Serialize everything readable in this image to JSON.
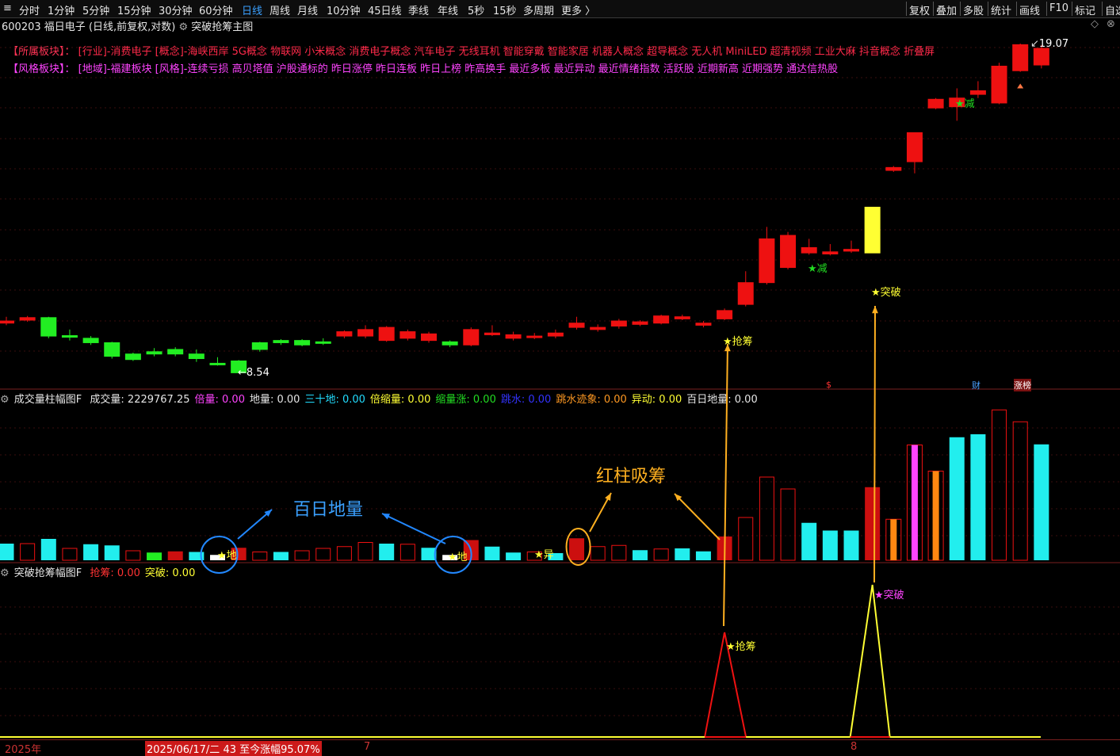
{
  "toolbar": {
    "periods": [
      "分时",
      "1分钟",
      "5分钟",
      "15分钟",
      "30分钟",
      "60分钟",
      "日线",
      "周线",
      "月线",
      "10分钟",
      "45日线",
      "季线",
      "年线",
      "5秒",
      "15秒",
      "多周期",
      "更多 〉"
    ],
    "active": "日线",
    "right_buttons": [
      "复权",
      "叠加",
      "多股",
      "统计",
      "画线",
      "F10",
      "标记",
      "自选"
    ]
  },
  "stock": {
    "code": "600203",
    "name": "福日电子",
    "mode": "(日线,前复权,对数)",
    "indicator": "突破抢筹主图"
  },
  "sectors": {
    "row1_label": "【所属板块】：",
    "row1_text": "[行业]-消费电子 [概念]-海峡西岸 5G概念 物联网 小米概念 消费电子概念 汽车电子 无线耳机 智能穿戴 智能家居 机器人概念 超导概念 无人机 MiniLED 超清视频 工业大麻 抖音概念 折叠屏",
    "row2_label": "【风格板块】：",
    "row2_text": "[地域]-福建板块 [风格]-连续亏损 高贝塔值 沪股通标的 昨日涨停 昨日连板 昨日上榜 昨高换手 最近多板 最近异动 最近情绪指数 活跃股 近期新高 近期强势 通达信热股"
  },
  "main_chart": {
    "high_label": "19.07",
    "low_label": "8.54",
    "low_arrow": "←",
    "signals": {
      "qiangchou": "★抢筹",
      "tupo": "★突破",
      "jian": "★减"
    },
    "markers": {
      "dollar": "$",
      "cai": "财",
      "zhangbang": "涨榜"
    }
  },
  "volume_panel": {
    "title": "成交量柱幅图F",
    "fields": [
      {
        "k": "成交量:",
        "v": "2229767.25",
        "color": "#e6e6e6"
      },
      {
        "k": "倍量:",
        "v": "0.00",
        "color": "#ff44ff"
      },
      {
        "k": "地量:",
        "v": "0.00",
        "color": "#e6e6e6"
      },
      {
        "k": "三十地:",
        "v": "0.00",
        "color": "#22ddff"
      },
      {
        "k": "倍缩量:",
        "v": "0.00",
        "color": "#ffff33"
      },
      {
        "k": "缩量涨:",
        "v": "0.00",
        "color": "#22dd22"
      },
      {
        "k": "跳水:",
        "v": "0.00",
        "color": "#3333ff"
      },
      {
        "k": "跳水迹象:",
        "v": "0.00",
        "color": "#ff9922"
      },
      {
        "k": "异动:",
        "v": "0.00",
        "color": "#ffff33"
      },
      {
        "k": "百日地量:",
        "v": "0.00",
        "color": "#e6e6e6"
      }
    ],
    "tags": {
      "di": "★地",
      "yi": "★异"
    },
    "annotations": {
      "bairi": "百日地量",
      "hongzhu": "红柱吸筹"
    }
  },
  "breakout_panel": {
    "title": "突破抢筹幅图F",
    "fields": [
      {
        "k": "抢筹:",
        "v": "0.00",
        "color": "#ff3333"
      },
      {
        "k": "突破:",
        "v": "0.00",
        "color": "#ffff33"
      }
    ],
    "peak_labels": {
      "qiangchou": "★抢筹",
      "tupo": "★突破"
    }
  },
  "status_bar": {
    "year": "2025年",
    "info": "2025/06/17/二 43 至今涨幅95.07%",
    "mark7": "7",
    "mark8": "8"
  },
  "candles": [
    {
      "t": "u",
      "o": 9.65,
      "c": 9.7,
      "h": 9.8,
      "l": 9.6
    },
    {
      "t": "u",
      "o": 9.72,
      "c": 9.78,
      "h": 9.82,
      "l": 9.68
    },
    {
      "t": "d",
      "o": 9.78,
      "c": 9.35,
      "h": 9.8,
      "l": 9.3
    },
    {
      "t": "d",
      "o": 9.36,
      "c": 9.33,
      "h": 9.5,
      "l": 9.25
    },
    {
      "t": "d",
      "o": 9.3,
      "c": 9.2,
      "h": 9.35,
      "l": 9.15
    },
    {
      "t": "d",
      "o": 9.2,
      "c": 8.9,
      "h": 9.22,
      "l": 8.85
    },
    {
      "t": "d",
      "o": 8.95,
      "c": 8.83,
      "h": 8.98,
      "l": 8.8
    },
    {
      "t": "d",
      "o": 9.0,
      "c": 8.95,
      "h": 9.08,
      "l": 8.9
    },
    {
      "t": "d",
      "o": 9.05,
      "c": 8.95,
      "h": 9.1,
      "l": 8.9
    },
    {
      "t": "d",
      "o": 8.95,
      "c": 8.85,
      "h": 9.05,
      "l": 8.78
    },
    {
      "t": "d",
      "o": 8.75,
      "c": 8.73,
      "h": 8.88,
      "l": 8.7
    },
    {
      "t": "d",
      "o": 8.8,
      "c": 8.55,
      "h": 8.82,
      "l": 8.54
    },
    {
      "t": "d",
      "o": 9.2,
      "c": 9.05,
      "h": 9.22,
      "l": 9.0
    },
    {
      "t": "d",
      "o": 9.25,
      "c": 9.2,
      "h": 9.28,
      "l": 9.15
    },
    {
      "t": "d",
      "o": 9.25,
      "c": 9.15,
      "h": 9.28,
      "l": 9.12
    },
    {
      "t": "d",
      "o": 9.22,
      "c": 9.2,
      "h": 9.3,
      "l": 9.15
    },
    {
      "t": "u",
      "o": 9.35,
      "c": 9.45,
      "h": 9.48,
      "l": 9.3
    },
    {
      "t": "u",
      "o": 9.35,
      "c": 9.5,
      "h": 9.6,
      "l": 9.3
    },
    {
      "t": "u",
      "o": 9.25,
      "c": 9.55,
      "h": 9.58,
      "l": 9.22
    },
    {
      "t": "u",
      "o": 9.3,
      "c": 9.45,
      "h": 9.5,
      "l": 9.25
    },
    {
      "t": "u",
      "o": 9.25,
      "c": 9.4,
      "h": 9.45,
      "l": 9.2
    },
    {
      "t": "d",
      "o": 9.22,
      "c": 9.15,
      "h": 9.25,
      "l": 9.1
    },
    {
      "t": "u",
      "o": 9.15,
      "c": 9.5,
      "h": 9.55,
      "l": 9.12
    },
    {
      "t": "u",
      "o": 9.38,
      "c": 9.42,
      "h": 9.6,
      "l": 9.35
    },
    {
      "t": "u",
      "o": 9.3,
      "c": 9.38,
      "h": 9.45,
      "l": 9.25
    },
    {
      "t": "u",
      "o": 9.32,
      "c": 9.35,
      "h": 9.42,
      "l": 9.28
    },
    {
      "t": "u",
      "o": 9.35,
      "c": 9.42,
      "h": 9.5,
      "l": 9.3
    },
    {
      "t": "u",
      "o": 9.55,
      "c": 9.65,
      "h": 9.8,
      "l": 9.5
    },
    {
      "t": "u",
      "o": 9.5,
      "c": 9.55,
      "h": 9.62,
      "l": 9.45
    },
    {
      "t": "u",
      "o": 9.58,
      "c": 9.7,
      "h": 9.75,
      "l": 9.52
    },
    {
      "t": "u",
      "o": 9.62,
      "c": 9.68,
      "h": 9.72,
      "l": 9.58
    },
    {
      "t": "u",
      "o": 9.65,
      "c": 9.82,
      "h": 9.85,
      "l": 9.62
    },
    {
      "t": "u",
      "o": 9.75,
      "c": 9.8,
      "h": 9.85,
      "l": 9.72
    },
    {
      "t": "u",
      "o": 9.6,
      "c": 9.65,
      "h": 9.7,
      "l": 9.55
    },
    {
      "t": "u",
      "o": 9.75,
      "c": 9.95,
      "h": 10.0,
      "l": 9.72
    },
    {
      "t": "u",
      "o": 10.1,
      "c": 10.65,
      "h": 10.95,
      "l": 10.05
    },
    {
      "t": "u",
      "o": 10.65,
      "c": 11.85,
      "h": 12.2,
      "l": 10.6
    },
    {
      "t": "u",
      "o": 11.05,
      "c": 11.95,
      "h": 12.05,
      "l": 11.0
    },
    {
      "t": "u",
      "o": 11.45,
      "c": 11.6,
      "h": 11.85,
      "l": 11.4
    },
    {
      "t": "u",
      "o": 11.42,
      "c": 11.48,
      "h": 11.7,
      "l": 11.38
    },
    {
      "t": "u",
      "o": 11.5,
      "c": 11.55,
      "h": 11.8,
      "l": 11.45
    },
    {
      "t": "y",
      "o": 11.45,
      "c": 12.8,
      "h": 12.8,
      "l": 11.45
    },
    {
      "t": "u",
      "o": 14.0,
      "c": 14.1,
      "h": 14.15,
      "l": 13.95
    },
    {
      "t": "u",
      "o": 14.3,
      "c": 15.35,
      "h": 15.35,
      "l": 13.9
    },
    {
      "t": "u",
      "o": 16.3,
      "c": 16.65,
      "h": 16.7,
      "l": 16.25
    },
    {
      "t": "u",
      "o": 16.35,
      "c": 16.7,
      "h": 17.1,
      "l": 15.8
    },
    {
      "t": "u",
      "o": 16.85,
      "c": 17.0,
      "h": 17.4,
      "l": 16.7
    },
    {
      "t": "u",
      "o": 16.5,
      "c": 18.05,
      "h": 18.2,
      "l": 16.45
    },
    {
      "t": "u",
      "o": 17.85,
      "c": 19.02,
      "h": 19.07,
      "l": 17.8
    },
    {
      "t": "u",
      "o": 18.1,
      "c": 18.85,
      "h": 19.0,
      "l": 17.95
    }
  ],
  "volumes": [
    {
      "v": 0.28,
      "s": "cyan"
    },
    {
      "v": 0.28,
      "s": "hollow"
    },
    {
      "v": 0.36,
      "s": "cyan"
    },
    {
      "v": 0.2,
      "s": "hollow"
    },
    {
      "v": 0.27,
      "s": "cyan"
    },
    {
      "v": 0.25,
      "s": "cyan"
    },
    {
      "v": 0.16,
      "s": "hollow"
    },
    {
      "v": 0.13,
      "s": "green"
    },
    {
      "v": 0.15,
      "s": "red"
    },
    {
      "v": 0.14,
      "s": "cyan"
    },
    {
      "v": 0.09,
      "s": "white"
    },
    {
      "v": 0.21,
      "s": "red"
    },
    {
      "v": 0.14,
      "s": "hollow"
    },
    {
      "v": 0.14,
      "s": "cyan"
    },
    {
      "v": 0.16,
      "s": "hollow"
    },
    {
      "v": 0.2,
      "s": "hollow"
    },
    {
      "v": 0.23,
      "s": "hollow"
    },
    {
      "v": 0.3,
      "s": "hollow"
    },
    {
      "v": 0.28,
      "s": "cyan"
    },
    {
      "v": 0.27,
      "s": "hollow"
    },
    {
      "v": 0.21,
      "s": "cyan"
    },
    {
      "v": 0.09,
      "s": "white"
    },
    {
      "v": 0.34,
      "s": "red"
    },
    {
      "v": 0.23,
      "s": "cyan"
    },
    {
      "v": 0.13,
      "s": "cyan"
    },
    {
      "v": 0.14,
      "s": "hollow"
    },
    {
      "v": 0.12,
      "s": "cyan"
    },
    {
      "v": 0.37,
      "s": "red"
    },
    {
      "v": 0.23,
      "s": "hollow"
    },
    {
      "v": 0.25,
      "s": "hollow"
    },
    {
      "v": 0.17,
      "s": "cyan"
    },
    {
      "v": 0.19,
      "s": "hollow"
    },
    {
      "v": 0.2,
      "s": "cyan"
    },
    {
      "v": 0.15,
      "s": "cyan"
    },
    {
      "v": 0.4,
      "s": "red"
    },
    {
      "v": 0.72,
      "s": "hollow"
    },
    {
      "v": 1.4,
      "s": "hollow"
    },
    {
      "v": 1.2,
      "s": "hollow"
    },
    {
      "v": 0.63,
      "s": "cyan"
    },
    {
      "v": 0.5,
      "s": "cyan"
    },
    {
      "v": 0.5,
      "s": "cyan"
    },
    {
      "v": 1.23,
      "s": "red"
    },
    {
      "v": 0.69,
      "s": "orange"
    },
    {
      "v": 1.94,
      "s": "magenta"
    },
    {
      "v": 1.5,
      "s": "orange"
    },
    {
      "v": 2.07,
      "s": "cyan"
    },
    {
      "v": 2.12,
      "s": "cyan"
    },
    {
      "v": 2.53,
      "s": "hollow"
    },
    {
      "v": 2.33,
      "s": "hollow"
    },
    {
      "v": 1.95,
      "s": "cyan"
    }
  ]
}
